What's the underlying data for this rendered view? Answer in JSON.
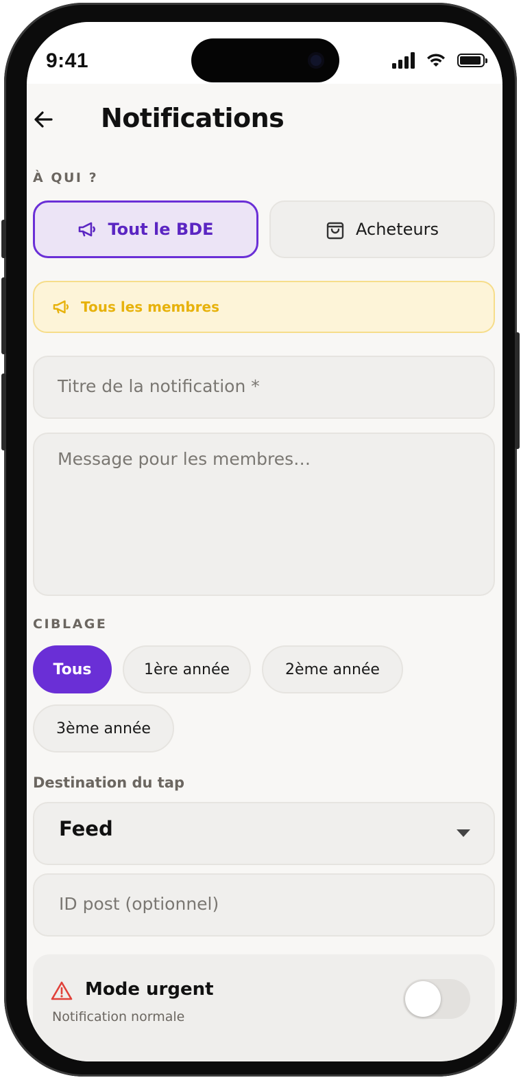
{
  "status_bar": {
    "time": "9:41"
  },
  "header": {
    "title": "Notifications",
    "back_icon": "arrow-left-icon"
  },
  "audience": {
    "label": "À QUI ?",
    "options": [
      {
        "label": "Tout le BDE",
        "icon": "megaphone-icon",
        "selected": true
      },
      {
        "label": "Acheteurs",
        "icon": "shopping-bag-icon",
        "selected": false
      }
    ],
    "banner": {
      "icon": "megaphone-icon",
      "text": "Tous les membres"
    }
  },
  "form": {
    "title_placeholder": "Titre de la notification *",
    "message_placeholder": "Message pour les membres…"
  },
  "targeting": {
    "label": "CIBLAGE",
    "chips": [
      {
        "label": "Tous",
        "selected": true
      },
      {
        "label": "1ère année",
        "selected": false
      },
      {
        "label": "2ème année",
        "selected": false
      },
      {
        "label": "3ème année",
        "selected": false
      }
    ]
  },
  "destination": {
    "label": "Destination du tap",
    "selected": "Feed",
    "post_id_placeholder": "ID post (optionnel)"
  },
  "urgent": {
    "icon": "warning-triangle-icon",
    "title": "Mode urgent",
    "subtitle": "Notification normale",
    "enabled": false
  },
  "colors": {
    "accent": "#6a2fd6",
    "accent_bg": "#ece4f6",
    "warning_text": "#e7b20c",
    "warning_bg": "#fdf4d8",
    "danger": "#e0413a"
  }
}
